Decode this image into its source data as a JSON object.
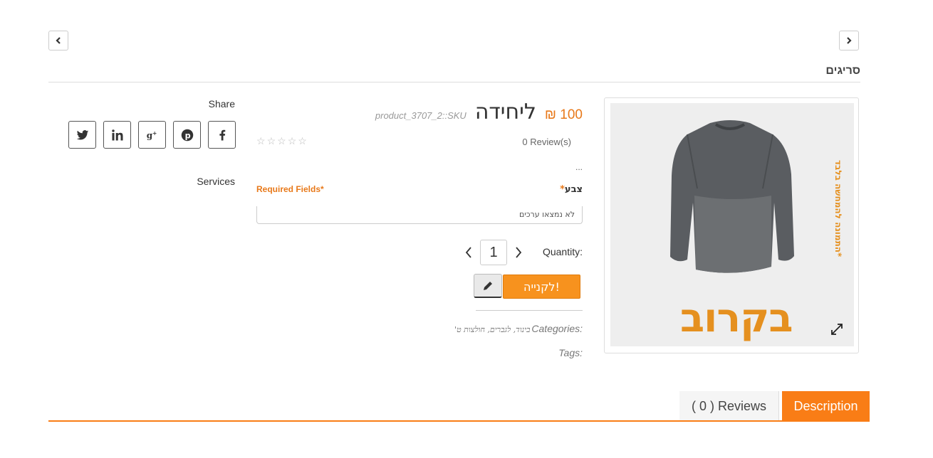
{
  "nav": {
    "prev_icon": "chevron-left-icon",
    "next_icon": "chevron-right-icon"
  },
  "category_title": "סריגים",
  "product": {
    "price": "100 ₪",
    "unit_label": "ליחידה",
    "sku": "product_3707_2::SKU",
    "rating_stars": 0,
    "reviews_text": "0 Review(s)",
    "short_description": "...",
    "image_overlay_text": "בקרוב",
    "image_side_note": "*התמונה להמחשה בלבד",
    "expand_icon": "expand-icon"
  },
  "options": {
    "color_label": "צבע",
    "required_marker": "*",
    "required_note": "Required Fields*",
    "color_value": "לא נמצאו ערכים"
  },
  "quantity": {
    "label": "Quantity:",
    "value": "1"
  },
  "actions": {
    "buy_label": "לקנייה!",
    "edit_icon": "pencil-icon"
  },
  "meta": {
    "categories_label": "Categories:",
    "categories_values": "בינוד, לגברים, חולצות ט'",
    "tags_label": "Tags:"
  },
  "share": {
    "label": "Share",
    "icons": [
      "twitter-icon",
      "linkedin-icon",
      "google-plus-icon",
      "pinterest-icon",
      "facebook-icon"
    ]
  },
  "services_label": "Services",
  "tabs": {
    "description": "Description",
    "reviews": "( 0 ) Reviews"
  },
  "colors": {
    "accent": "#f97d16",
    "price": "#e8791a",
    "overlay": "#e5901f"
  }
}
